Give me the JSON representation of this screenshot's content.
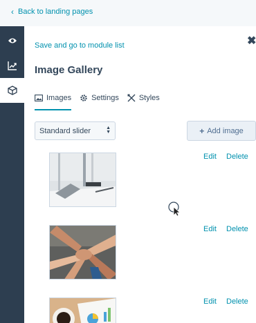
{
  "topbar": {
    "back_label": "Back to landing pages"
  },
  "rail": {
    "items": [
      "eye-icon",
      "chart-icon",
      "module-icon"
    ],
    "active": "module-icon"
  },
  "panel": {
    "save_link": "Save and go to module list",
    "title": "Image Gallery",
    "tabs": [
      {
        "label": "Images",
        "icon": "image-icon",
        "active": true
      },
      {
        "label": "Settings",
        "icon": "gear-icon",
        "active": false
      },
      {
        "label": "Styles",
        "icon": "brush-icon",
        "active": false
      }
    ],
    "display_mode": {
      "value": "Standard slider"
    },
    "add_image_label": "Add image",
    "images": [
      {
        "subject": "laptop and lamp on desk",
        "edit": "Edit",
        "delete": "Delete"
      },
      {
        "subject": "stacked hands teamwork",
        "edit": "Edit",
        "delete": "Delete"
      },
      {
        "subject": "coffee cup and charts",
        "edit": "Edit",
        "delete": "Delete"
      }
    ]
  },
  "colors": {
    "accent": "#0091ae",
    "rail": "#2d3e50",
    "text": "#33475b",
    "border": "#cbd6e2"
  }
}
